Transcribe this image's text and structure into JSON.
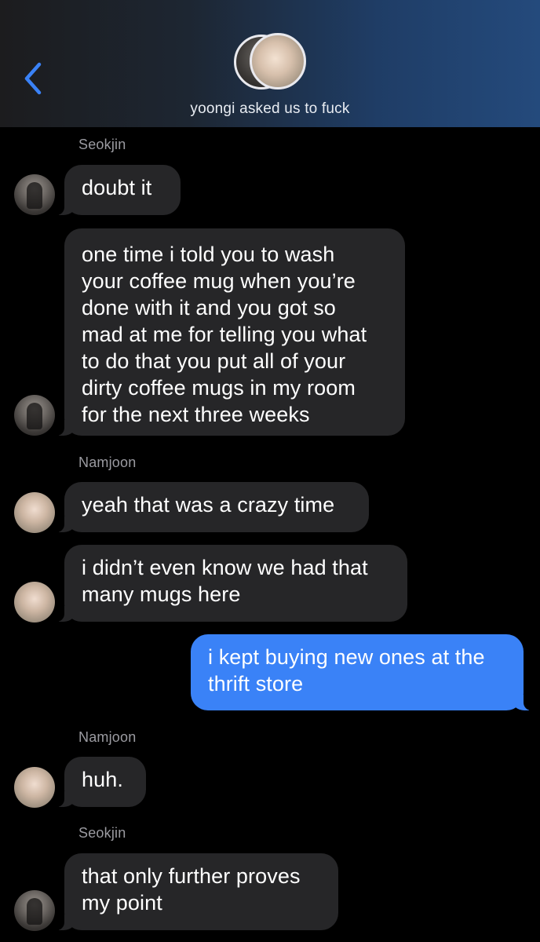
{
  "header": {
    "title": "yoongi asked us to fuck",
    "back_icon": "chevron-left-icon",
    "accent_color": "#3a82f7"
  },
  "messages": [
    {
      "sender_label": "Seokjin",
      "avatar": "seokjin",
      "direction": "in",
      "lines": [
        "doubt it"
      ]
    },
    {
      "avatar": "seokjin",
      "direction": "in",
      "lines": [
        "one time i told you to wash",
        "your coffee mug when you’re",
        "done with it and you got so",
        "mad at me for telling you what",
        "to do that you put all of your",
        "dirty coffee mugs in my room",
        "for the next three weeks"
      ]
    },
    {
      "sender_label": "Namjoon",
      "avatar": "namjoon",
      "direction": "in",
      "lines": [
        "yeah that was a crazy time"
      ]
    },
    {
      "avatar": "namjoon",
      "direction": "in",
      "lines": [
        "i didn’t even know we had that",
        "many mugs here"
      ]
    },
    {
      "direction": "out",
      "lines": [
        "i kept buying new ones at the",
        "thrift store"
      ]
    },
    {
      "sender_label": "Namjoon",
      "avatar": "namjoon",
      "direction": "in",
      "lines": [
        "huh."
      ]
    },
    {
      "sender_label": "Seokjin",
      "avatar": "seokjin",
      "direction": "in",
      "lines": [
        "that only further proves",
        "my point"
      ]
    }
  ],
  "colors": {
    "incoming_bubble": "#262628",
    "outgoing_bubble": "#3a82f7",
    "sender_label": "#9b9ba1"
  }
}
